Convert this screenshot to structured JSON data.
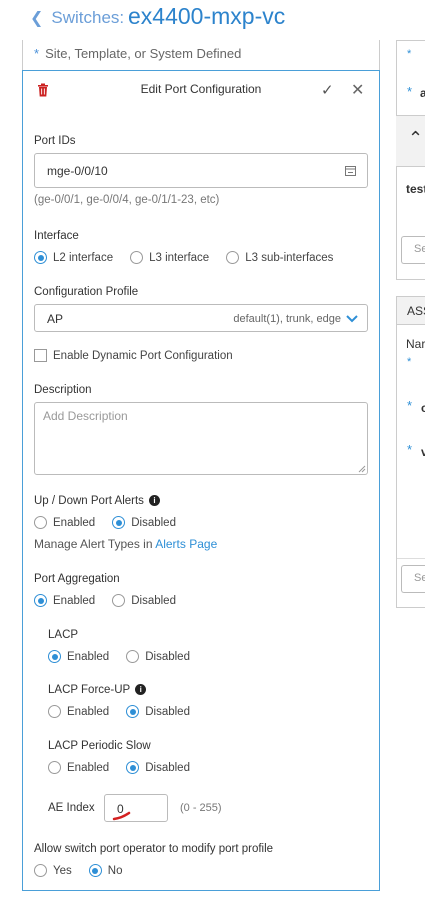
{
  "header": {
    "back_label": "Switches:",
    "device_name": "ex4400-mxp-vc"
  },
  "top_note": "Site, Template, or System Defined",
  "panel": {
    "title": "Edit Port Configuration",
    "port_ids": {
      "label": "Port IDs",
      "value": "mge-0/0/10",
      "hint": "(ge-0/0/1, ge-0/0/4, ge-0/1/1-23, etc)"
    },
    "interface": {
      "label": "Interface",
      "options": [
        "L2 interface",
        "L3 interface",
        "L3 sub-interfaces"
      ],
      "selected": "L2 interface"
    },
    "config_profile": {
      "label": "Configuration Profile",
      "value": "AP",
      "detail": "default(1), trunk, edge"
    },
    "dynamic_port": {
      "label": "Enable Dynamic Port Configuration",
      "checked": false
    },
    "description": {
      "label": "Description",
      "placeholder": "Add Description"
    },
    "port_alerts": {
      "label": "Up / Down Port Alerts",
      "enabled": "Enabled",
      "disabled": "Disabled",
      "selected": "Disabled",
      "manage_text": "Manage Alert Types in",
      "manage_link": "Alerts Page"
    },
    "port_aggregation": {
      "label": "Port Aggregation",
      "enabled": "Enabled",
      "disabled": "Disabled",
      "selected": "Enabled"
    },
    "lacp": {
      "label": "LACP",
      "enabled": "Enabled",
      "disabled": "Disabled",
      "selected": "Enabled"
    },
    "lacp_force_up": {
      "label": "LACP Force-UP",
      "enabled": "Enabled",
      "disabled": "Disabled",
      "selected": "Disabled"
    },
    "lacp_periodic_slow": {
      "label": "LACP Periodic Slow",
      "enabled": "Enabled",
      "disabled": "Disabled",
      "selected": "Disabled"
    },
    "ae_index": {
      "label": "AE Index",
      "value": "0",
      "range": "(0 - 255)"
    },
    "operator_modify": {
      "label": "Allow switch port operator to modify port profile",
      "yes": "Yes",
      "no": "No",
      "selected": "No"
    }
  },
  "right_column": {
    "item_a": "a",
    "item_test": "test",
    "search_placeholder": "Se",
    "section_title": "ASS",
    "name_label": "Nar",
    "item_c": "c",
    "item_v": "v",
    "search_placeholder_2": "Se"
  },
  "colors": {
    "accent": "#2e8fd6",
    "title": "#2c83cc",
    "delete": "#cc2222",
    "annotation": "#d42020"
  }
}
